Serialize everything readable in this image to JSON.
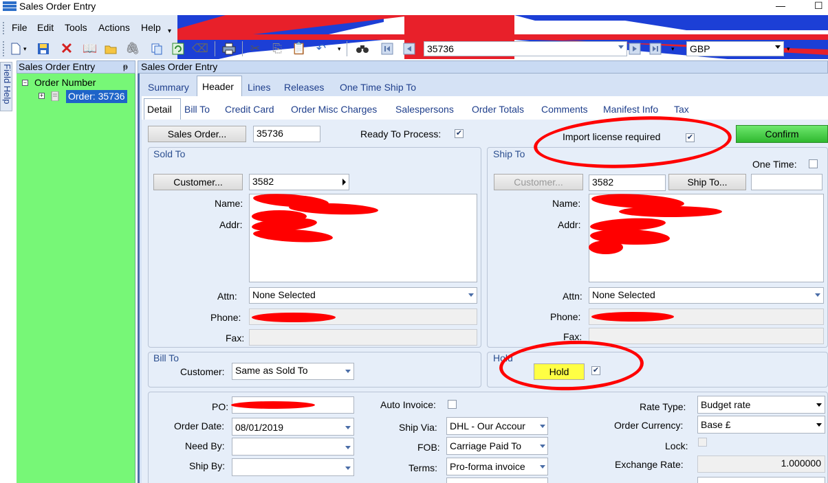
{
  "window": {
    "title": "Sales Order Entry",
    "minimize": "—",
    "maximize": "☐"
  },
  "menu": [
    "File",
    "Edit",
    "Tools",
    "Actions",
    "Help"
  ],
  "toolbar": {
    "order_combo": "35736",
    "currency_combo": "GBP"
  },
  "side_tab": {
    "label": "Field Help"
  },
  "tree": {
    "panel_title": "Sales Order Entry",
    "pin": "ᵽ",
    "root": "Order Number",
    "child": "Order: 35736"
  },
  "main": {
    "panel_title": "Sales Order Entry"
  },
  "tabs_top": [
    "Summary",
    "Header",
    "Lines",
    "Releases",
    "One Time Ship To"
  ],
  "tabs_sub": [
    "Detail",
    "Bill To",
    "Credit Card",
    "Order Misc Charges",
    "Salespersons",
    "Order Totals",
    "Comments",
    "Manifest Info",
    "Tax"
  ],
  "header": {
    "sales_order_btn": "Sales Order...",
    "sales_order_value": "35736",
    "ready_label": "Ready To Process:",
    "import_label": "Import license required",
    "confirm": "Confirm"
  },
  "sold_to": {
    "title": "Sold To",
    "customer_btn": "Customer...",
    "customer_value": "3582",
    "name": "Name:",
    "addr": "Addr:",
    "attn": "Attn:",
    "attn_value": "None Selected",
    "phone": "Phone:",
    "fax": "Fax:"
  },
  "ship_to": {
    "title": "Ship To",
    "one_time": "One Time:",
    "customer_btn": "Customer...",
    "customer_value": "3582",
    "ship_to_btn": "Ship To...",
    "name": "Name:",
    "addr": "Addr:",
    "attn": "Attn:",
    "attn_value": "None Selected",
    "phone": "Phone:",
    "fax": "Fax:"
  },
  "bill_to": {
    "title": "Bill To",
    "customer": "Customer:",
    "customer_value": "Same as Sold To"
  },
  "hold": {
    "title": "Hold",
    "button": "Hold"
  },
  "order": {
    "po": "PO:",
    "order_date": "Order Date:",
    "order_date_value": "08/01/2019",
    "need_by": "Need By:",
    "ship_by": "Ship By:",
    "auto_invoice": "Auto Invoice:",
    "ship_via": "Ship Via:",
    "ship_via_value": "DHL - Our Accour",
    "fob": "FOB:",
    "fob_value": "Carriage Paid To",
    "terms": "Terms:",
    "terms_value": "Pro-forma invoice",
    "rate_type": "Rate Type:",
    "rate_type_value": "Budget rate",
    "order_currency": "Order Currency:",
    "order_currency_value": "Base £",
    "lock": "Lock:",
    "exchange_rate": "Exchange Rate:",
    "exchange_rate_value": "1.000000"
  },
  "colors": {
    "accent": "#1e64c8",
    "tree_bg": "#77f777",
    "confirm": "#3fc83f",
    "hold": "#ffff44",
    "annotation": "#ff0000"
  }
}
